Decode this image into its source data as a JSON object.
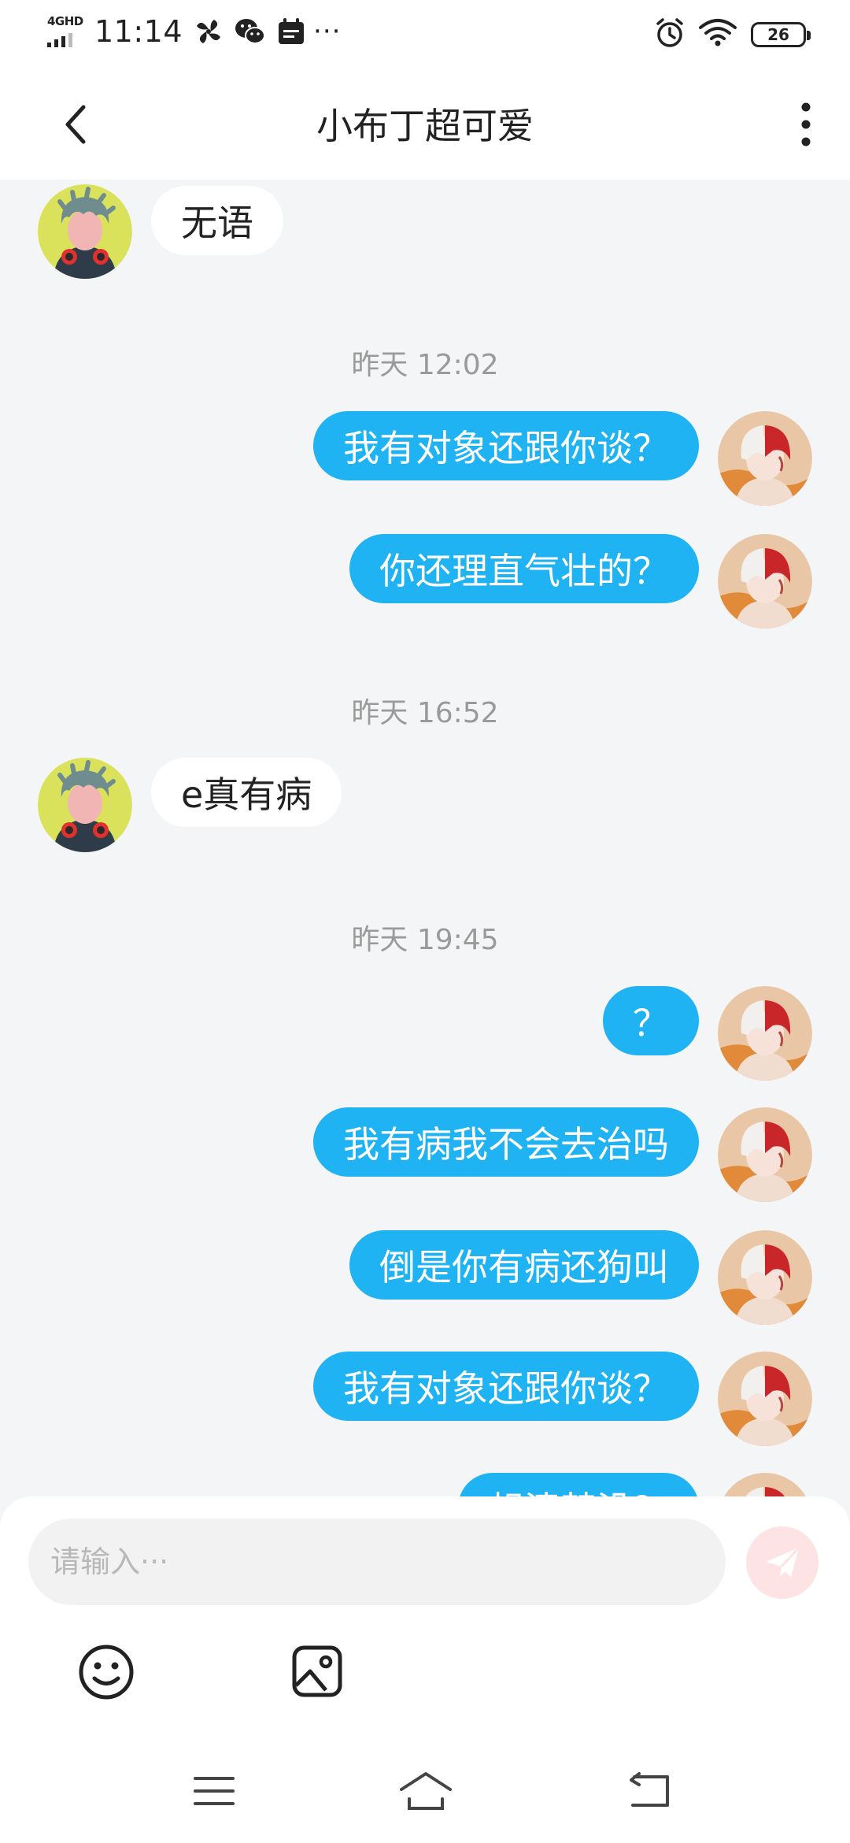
{
  "status_bar": {
    "network": "4GHD",
    "time": "11:14",
    "icons": [
      "pinwheel-icon",
      "wechat-icon",
      "calendar-icon"
    ],
    "more": "···",
    "right_icons": [
      "alarm-icon",
      "wifi-icon"
    ],
    "battery": "26"
  },
  "header": {
    "title": "小布丁超可爱",
    "back_icon": "chevron-left-icon",
    "more_icon": "more-vertical-icon"
  },
  "conversation": {
    "msg1": "无语",
    "time1": "昨天 12:02",
    "msg2": "我有对象还跟你谈？",
    "msg3": "你还理直气壮的？",
    "time2": "昨天 16:52",
    "msg4": "e真有病",
    "time3": "昨天 19:45",
    "msg5": "？",
    "msg6": "我有病我不会去治吗",
    "msg7": "倒是你有病还狗叫",
    "msg8": "我有对象还跟你谈？",
    "msg9": "想清楚没？"
  },
  "input": {
    "placeholder": "请输入···",
    "send_icon": "paper-plane-icon",
    "emoji_icon": "smiley-icon",
    "image_icon": "image-icon"
  },
  "colors": {
    "outgoing_bubble": "#1fb3f3",
    "incoming_bubble": "#ffffff",
    "chat_background": "#f4f5f7",
    "send_button": "#fde3e3",
    "timestamp": "#9a9a9a"
  }
}
